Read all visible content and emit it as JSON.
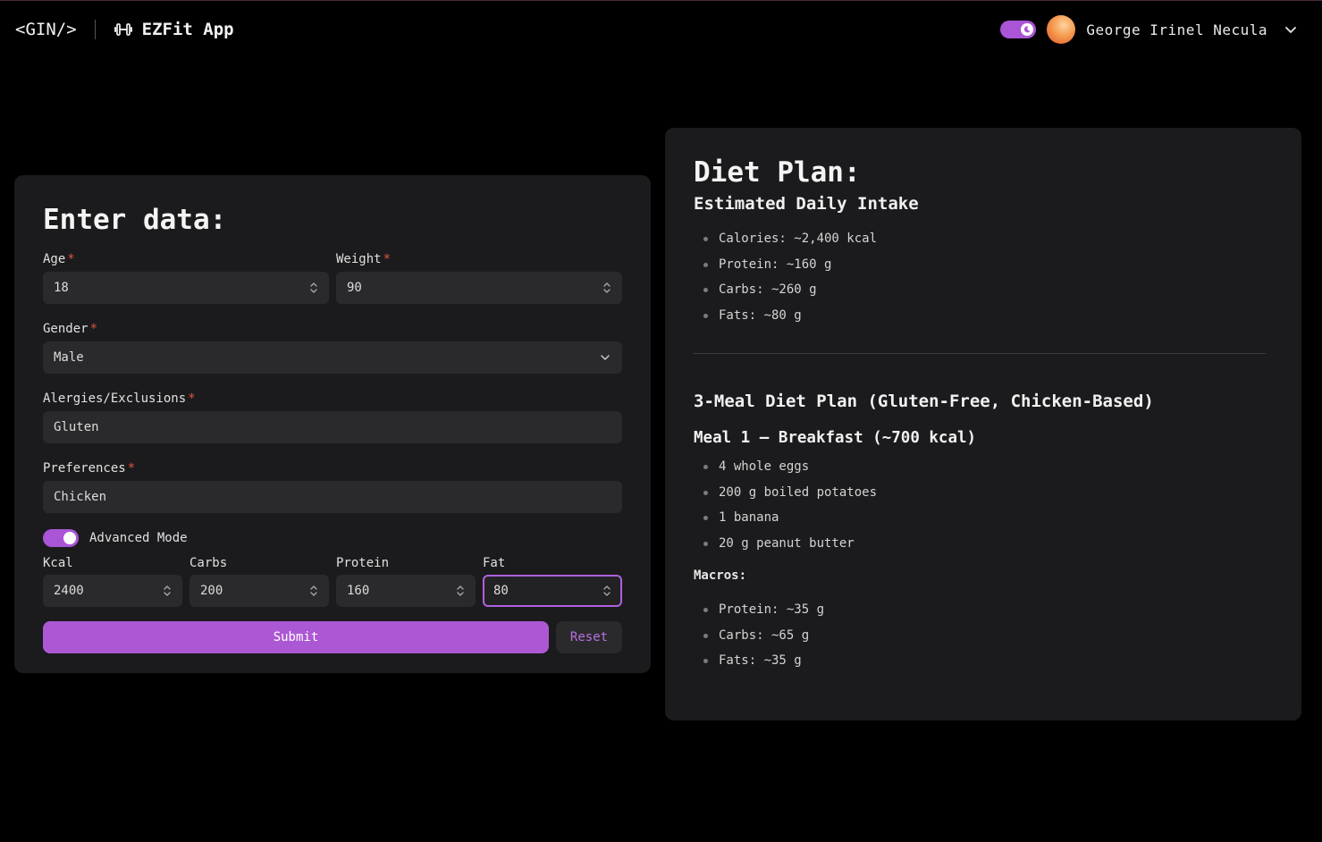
{
  "header": {
    "logo": "<GIN/>",
    "app_name": "EZFit App",
    "user_name": "George Irinel Necula"
  },
  "form": {
    "title": "Enter data:",
    "age": {
      "label": "Age",
      "value": "18"
    },
    "weight": {
      "label": "Weight",
      "value": "90"
    },
    "gender": {
      "label": "Gender",
      "value": "Male"
    },
    "allergies": {
      "label": "Alergies/Exclusions",
      "value": "Gluten"
    },
    "preferences": {
      "label": "Preferences",
      "value": "Chicken"
    },
    "required_mark": "*",
    "advanced_mode": {
      "label": "Advanced Mode",
      "enabled": true
    },
    "kcal": {
      "label": "Kcal",
      "value": "2400"
    },
    "carbs": {
      "label": "Carbs",
      "value": "200"
    },
    "protein": {
      "label": "Protein",
      "value": "160"
    },
    "fat": {
      "label": "Fat",
      "value": "80"
    },
    "submit_label": "Submit",
    "reset_label": "Reset"
  },
  "plan": {
    "title": "Diet Plan:",
    "intake_heading": "Estimated Daily Intake",
    "intake": [
      "Calories: ~2,400 kcal",
      "Protein: ~160 g",
      "Carbs: ~260 g",
      "Fats: ~80 g"
    ],
    "meal_plan_heading": "3-Meal Diet Plan (Gluten-Free, Chicken-Based)",
    "meal1_heading": "Meal 1 – Breakfast (~700 kcal)",
    "meal1_items": [
      "4 whole eggs",
      "200 g boiled potatoes",
      "1 banana",
      "20 g peanut butter"
    ],
    "macros_label": "Macros:",
    "meal1_macros": [
      "Protein: ~35 g",
      "Carbs: ~65 g",
      "Fats: ~35 g"
    ]
  },
  "colors": {
    "accent": "#ac58d4",
    "card_bg": "#1b1b1d",
    "input_bg": "#2a2a2c",
    "required": "#e2553f"
  }
}
